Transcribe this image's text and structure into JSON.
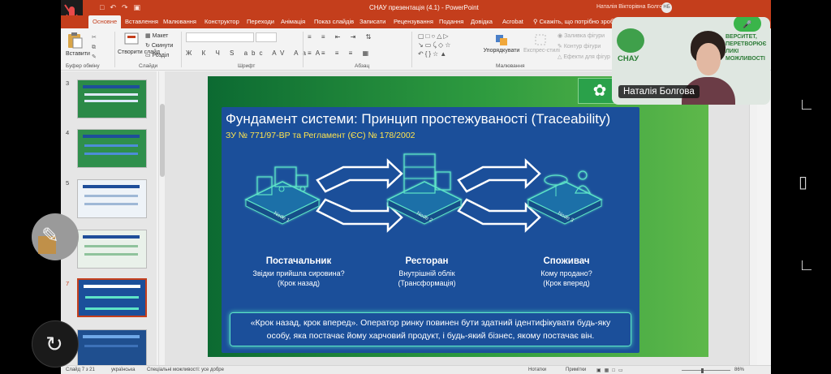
{
  "window": {
    "doc_title": "СНАУ презентація (4.1) - PowerPoint",
    "user_name": "Наталія Вікторівна Болгова",
    "user_initials": "НБ"
  },
  "tabs": [
    "Основне",
    "Вставлення",
    "Малювання",
    "Конструктор",
    "Переходи",
    "Анімація",
    "Показ слайдів",
    "Записати",
    "Рецензування",
    "Подання",
    "Довідка",
    "Acrobat"
  ],
  "tell_me": "Скажіть, що потрібно зроб",
  "ribbon": {
    "paste": "Вставити",
    "new_slide": "Створити слайд",
    "layout": "Макет",
    "reset": "Скинути",
    "section": "Розділ",
    "arrange": "Упорядкувати",
    "quick_styles": "Експрес-стилі",
    "shape_fill": "Заливка фігури",
    "shape_outline": "Контур фігури",
    "shape_effects": "Ефекти для фігур",
    "groups": {
      "clipboard": "Буфер обміну",
      "slides": "Слайди",
      "font": "Шрифт",
      "paragraph": "Абзац",
      "drawing": "Малювання"
    }
  },
  "thumbnails": [
    {
      "number": "3"
    },
    {
      "number": "4"
    },
    {
      "number": "5"
    },
    {
      "number": "6"
    },
    {
      "number": "7"
    },
    {
      "number": "8"
    }
  ],
  "slide": {
    "title": "Фундамент системи: Принцип простежуваності (Traceability)",
    "subtitle": "ЗУ № 771/97-ВР та Регламент (ЄС) № 178/2002",
    "nodes": [
      {
        "label": "Node 1",
        "name": "Постачальник",
        "desc1": "Звідки прийшла сировина?",
        "desc2": "(Крок назад)"
      },
      {
        "label": "Node 2",
        "name": "Ресторан",
        "desc1": "Внутрішній облік",
        "desc2": "(Трансформація)"
      },
      {
        "label": "Node 3",
        "name": "Споживач",
        "desc1": "Кому продано?",
        "desc2": "(Крок вперед)"
      }
    ],
    "quote_line1": "«Крок назад, крок вперед». Оператор ринку повинен бути здатний ідентифікувати будь-яку",
    "quote_line2": "особу, яка постачає йому харчовий продукт, і будь-який бізнес, якому постачає він."
  },
  "status": {
    "slide_count": "Слайд 7 з 21",
    "language": "українська",
    "accessibility": "Спеціальні можливості: усе добре",
    "notes": "Нотатки",
    "comments": "Примітки",
    "zoom": "86%"
  },
  "video": {
    "participant": "Наталія Болгова",
    "logo_text": "СНАУ",
    "bg_line1": "ВЕРСИТЕТ,",
    "bg_line2": "ПЕРЕТВОРЮЄ",
    "bg_line3": "ЛИКІ",
    "bg_line4": "МОЖЛИВОСТІ"
  },
  "colors": {
    "accent": "#c43e1c",
    "slide_panel": "#1b4f9a",
    "glow": "#5de4c7",
    "subtitle": "#ffe44d"
  }
}
